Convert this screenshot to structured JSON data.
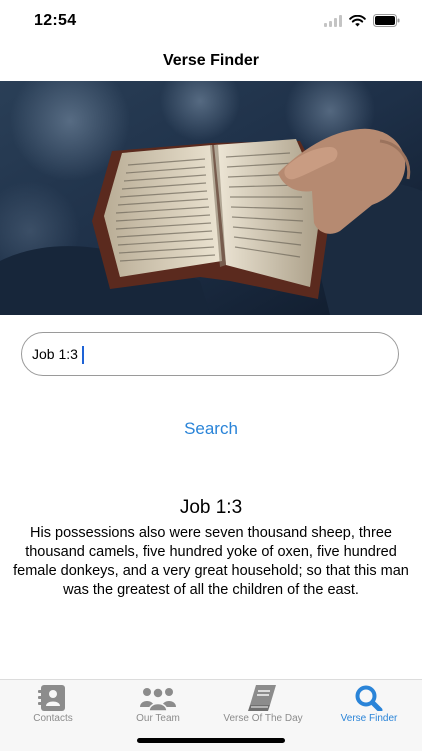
{
  "status": {
    "time": "12:54"
  },
  "nav": {
    "title": "Verse Finder"
  },
  "search": {
    "value": "Job 1:3",
    "button_label": "Search"
  },
  "result": {
    "reference": "Job 1:3",
    "text": "His possessions also were seven thousand sheep, three thousand camels, five hundred yoke of oxen, five hundred female donkeys, and a very great household; so that this man was the greatest of all the children of the east."
  },
  "tabs": [
    {
      "label": "Contacts",
      "icon": "contacts-icon"
    },
    {
      "label": "Our Team",
      "icon": "team-icon"
    },
    {
      "label": "Verse Of The Day",
      "icon": "book-icon"
    },
    {
      "label": "Verse Finder",
      "icon": "search-icon",
      "active": true
    }
  ],
  "colors": {
    "accent": "#2a84d8",
    "inactive": "#8c8c8c"
  }
}
